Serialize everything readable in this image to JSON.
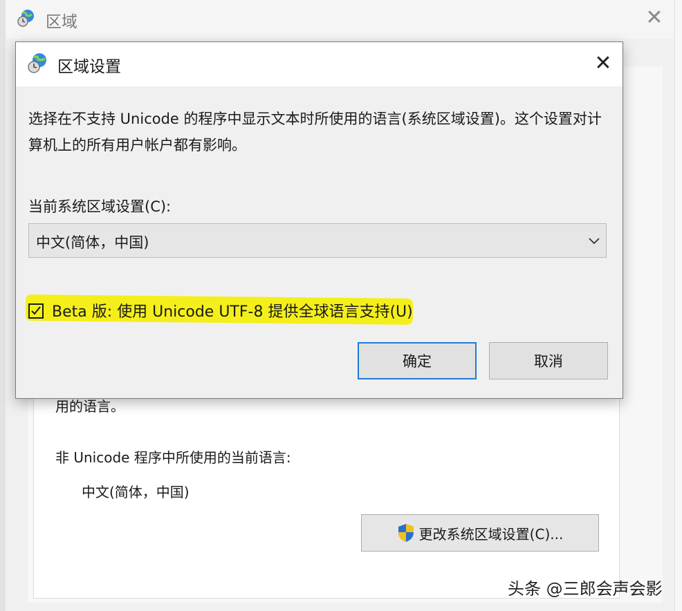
{
  "background_window": {
    "title": "区域",
    "panel_partial_text": "用的语言。",
    "non_unicode_label": "非 Unicode 程序中所使用的当前语言:",
    "current_language": "中文(简体，中国)",
    "change_button_label": "更改系统区域设置(C)..."
  },
  "dialog": {
    "title": "区域设置",
    "description": "选择在不支持 Unicode 的程序中显示文本时所使用的语言(系统区域设置)。这个设置对计算机上的所有用户帐户都有影响。",
    "locale_label": "当前系统区域设置(C):",
    "locale_selected": "中文(简体，中国)",
    "utf8_checkbox_label": "Beta 版: 使用 Unicode UTF-8 提供全球语言支持(U)",
    "utf8_checked": true,
    "ok_label": "确定",
    "cancel_label": "取消"
  },
  "watermark": "头条 @三郎会声会影",
  "colors": {
    "highlight": "#f4ef1a",
    "default_button_border": "#1e7ad6",
    "dialog_bg": "#f0f0f0"
  },
  "icons": [
    "globe-clock-icon",
    "close-icon",
    "chevron-down-icon",
    "checkmark-icon",
    "uac-shield-icon"
  ]
}
